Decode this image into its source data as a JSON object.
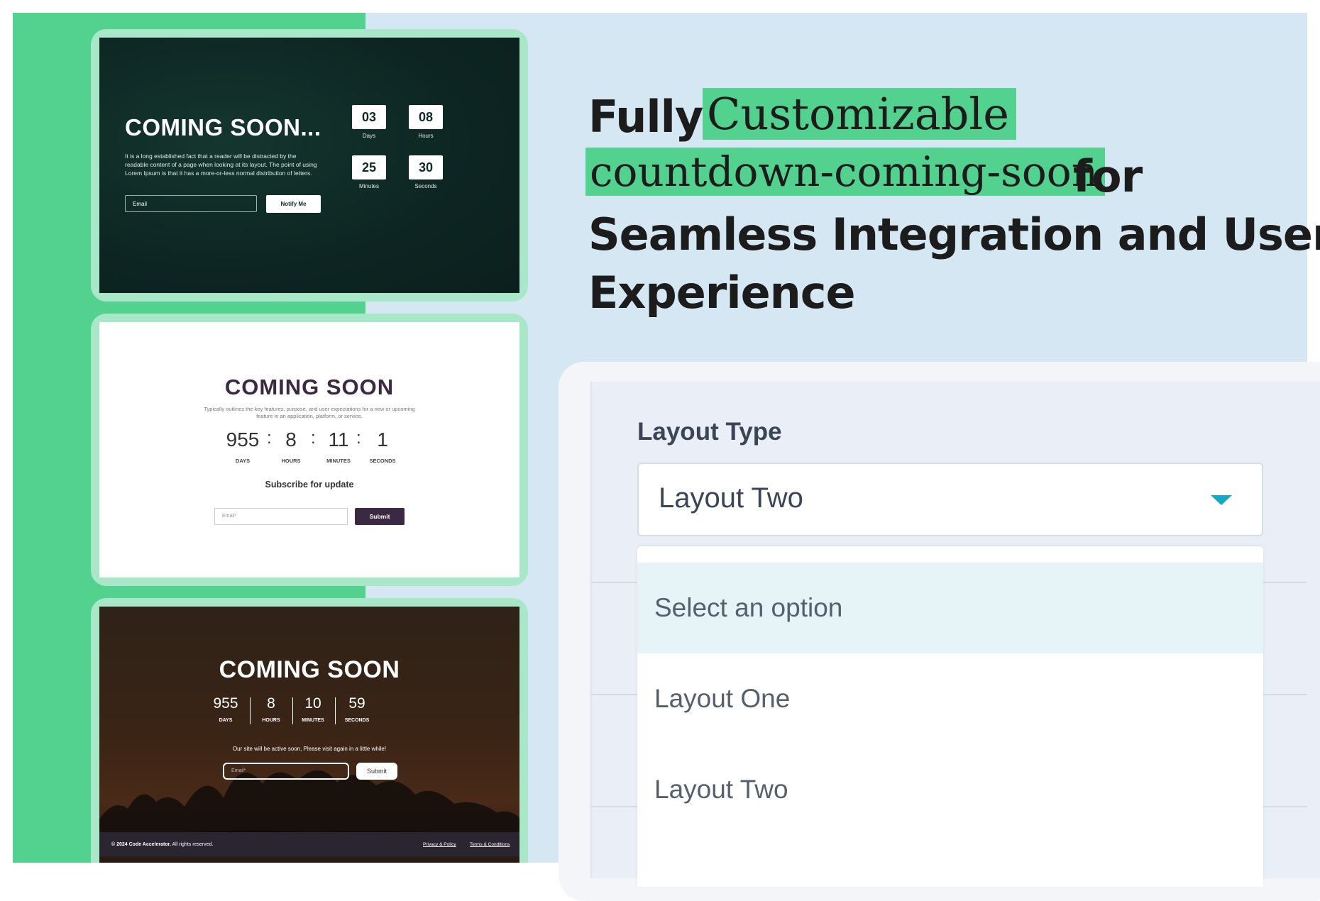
{
  "card1": {
    "title": "COMING SOON...",
    "description": "It is a long established fact that a reader will be distracted by the readable content of a page when looking at its layout. The point of using Lorem Ipsum is that it has a more-or-less normal distribution of letters.",
    "email_placeholder": "Email",
    "notify_label": "Notify Me",
    "countdown": [
      {
        "value": "03",
        "label": "Days"
      },
      {
        "value": "08",
        "label": "Hours"
      },
      {
        "value": "25",
        "label": "Minutes"
      },
      {
        "value": "30",
        "label": "Seconds"
      }
    ]
  },
  "card2": {
    "title": "COMING SOON",
    "description": "Typically outlines the key features, purpose, and user expectations for a new or upcoming feature in an application, platform, or service.",
    "countdown": [
      {
        "value": "955",
        "label": "DAYS"
      },
      {
        "value": "8",
        "label": "HOURS"
      },
      {
        "value": "11",
        "label": "MINUTES"
      },
      {
        "value": "1",
        "label": "SECONDS"
      }
    ],
    "separator": ":",
    "subscribe_heading": "Subscribe for update",
    "email_placeholder": "Email*",
    "submit_label": "Submit"
  },
  "card3": {
    "title": "COMING SOON",
    "countdown": [
      {
        "value": "955",
        "label": "DAYS"
      },
      {
        "value": "8",
        "label": "HOURS"
      },
      {
        "value": "10",
        "label": "MINUTES"
      },
      {
        "value": "59",
        "label": "SECONDS"
      }
    ],
    "message": "Our site will be active soon, Please visit again in a little while!",
    "email_placeholder": "Email*",
    "submit_label": "Submit",
    "footer": {
      "copyright_bold": "© 2024 Code Accelerator.",
      "copyright_rest": " All rights reserved.",
      "link1": "Privacy & Policy",
      "link2": "Terms & Conditions"
    }
  },
  "headline": {
    "word1": "Fully",
    "highlight1": "Customizable",
    "highlight2": "countdown-coming-soon",
    "word2": "for",
    "line3": "Seamless Integration and User",
    "line4": "Experience"
  },
  "settings": {
    "field_label": "Layout Type",
    "selected_value": "Layout Two",
    "options": [
      "Select an option",
      "Layout One",
      "Layout Two"
    ],
    "highlighted_option_index": 0
  },
  "colors": {
    "accent_green": "#53d18e",
    "background_blue": "#d5e7f2",
    "chevron_teal": "#17a8c6",
    "dark_purple": "#3b2843"
  },
  "icons": {
    "select_chevron": "chevron-down-icon"
  }
}
